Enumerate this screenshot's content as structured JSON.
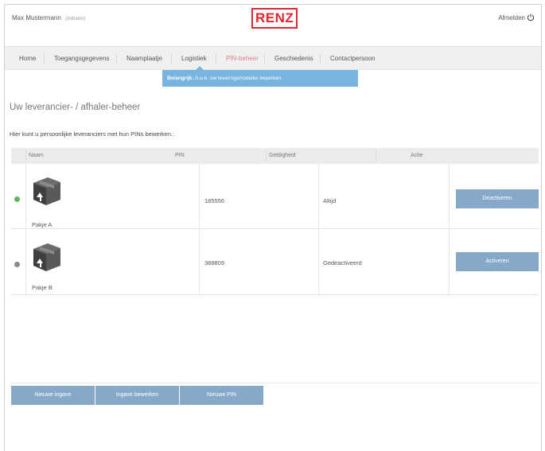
{
  "header": {
    "user_name": "Max Mustermann",
    "user_role": "(Initiator)",
    "logo_text": "RENZ",
    "logout_label": "Afmelden",
    "logout_icon": "power-icon"
  },
  "nav": {
    "items": [
      {
        "label": "Home"
      },
      {
        "label": "Toegangsgegevens"
      },
      {
        "label": "Naamplaatje"
      },
      {
        "label": "Logistiek"
      },
      {
        "label": "PIN-beheer"
      },
      {
        "label": "Geschiedenis"
      },
      {
        "label": "Contactpersoon"
      }
    ],
    "active_item": "Logistiek"
  },
  "notice": {
    "bold": "Belangrijk:",
    "text": " A.u.b. uw leveringsmodules beperken."
  },
  "page": {
    "heading": "Uw leverancier- / afhaler-beheer",
    "subtext": "Hier kunt u persoonlijke leveranciers met hun PINs bewerken.:"
  },
  "table": {
    "columns": [
      "Naam",
      "PIN",
      "Geldigheid",
      "Actie"
    ],
    "rows": [
      {
        "name": "Pakje A",
        "pin": "185556",
        "validity": "Altijd",
        "action": "Deactiveren",
        "status_color": "#5cb85c"
      },
      {
        "name": "Pakje B",
        "pin": "388809",
        "validity": "Gedeactiveerd",
        "action": "Activeren",
        "status_color": "#8c8c8c"
      }
    ],
    "row_icon": "package-icon"
  },
  "buttons": {
    "new_entry": "Nieuwe ingave",
    "edit_entry": "Ingave bewerken",
    "new_pin": "Nieuwe PIN"
  },
  "colors": {
    "brand": "#e3262c",
    "button": "#87a9c9",
    "notice": "#78b4e0"
  }
}
